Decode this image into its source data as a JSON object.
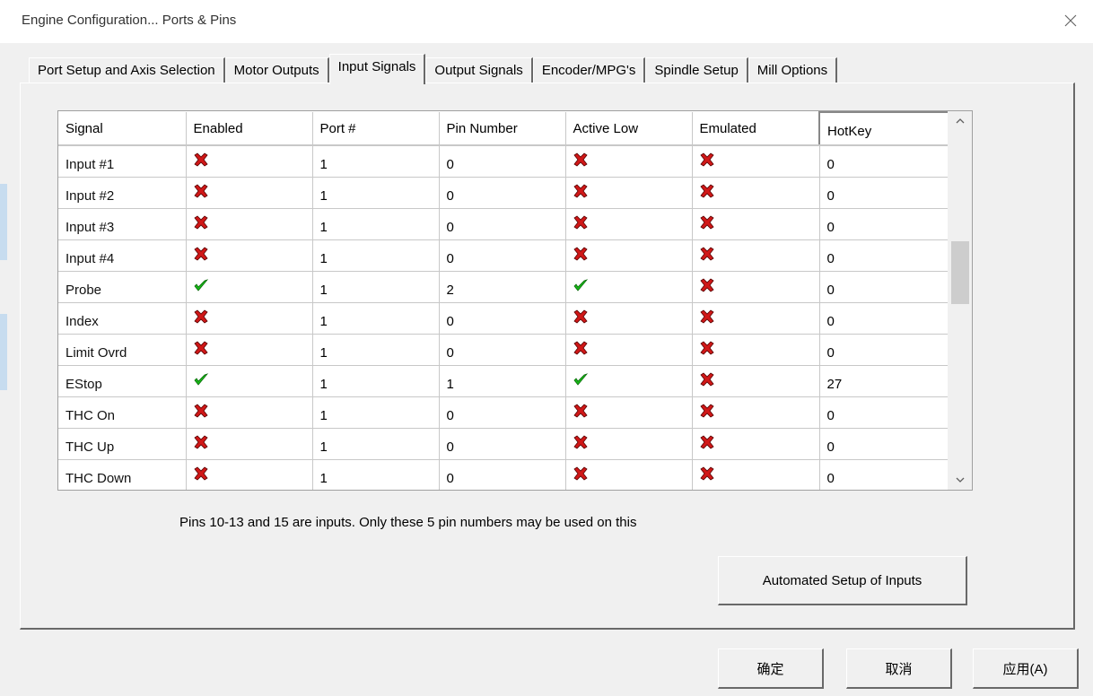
{
  "window": {
    "title": "Engine Configuration... Ports & Pins"
  },
  "tabs": [
    {
      "label": "Port Setup and Axis Selection"
    },
    {
      "label": "Motor Outputs"
    },
    {
      "label": "Input Signals"
    },
    {
      "label": "Output Signals"
    },
    {
      "label": "Encoder/MPG's"
    },
    {
      "label": "Spindle Setup"
    },
    {
      "label": "Mill Options"
    }
  ],
  "active_tab": "Input Signals",
  "table": {
    "columns": [
      "Signal",
      "Enabled",
      "Port #",
      "Pin Number",
      "Active Low",
      "Emulated",
      "HotKey"
    ],
    "rows": [
      {
        "signal": "Input #1",
        "enabled": "red-x-icon",
        "port": "1",
        "pin": "0",
        "active_low": "red-x-icon",
        "emulated": "red-x-icon",
        "hotkey": "0"
      },
      {
        "signal": "Input #2",
        "enabled": "red-x-icon",
        "port": "1",
        "pin": "0",
        "active_low": "red-x-icon",
        "emulated": "red-x-icon",
        "hotkey": "0"
      },
      {
        "signal": "Input #3",
        "enabled": "red-x-icon",
        "port": "1",
        "pin": "0",
        "active_low": "red-x-icon",
        "emulated": "red-x-icon",
        "hotkey": "0"
      },
      {
        "signal": "Input #4",
        "enabled": "red-x-icon",
        "port": "1",
        "pin": "0",
        "active_low": "red-x-icon",
        "emulated": "red-x-icon",
        "hotkey": "0"
      },
      {
        "signal": "Probe",
        "enabled": "green-check-icon",
        "port": "1",
        "pin": "2",
        "active_low": "green-check-icon",
        "emulated": "red-x-icon",
        "hotkey": "0"
      },
      {
        "signal": "Index",
        "enabled": "red-x-icon",
        "port": "1",
        "pin": "0",
        "active_low": "red-x-icon",
        "emulated": "red-x-icon",
        "hotkey": "0"
      },
      {
        "signal": "Limit Ovrd",
        "enabled": "red-x-icon",
        "port": "1",
        "pin": "0",
        "active_low": "red-x-icon",
        "emulated": "red-x-icon",
        "hotkey": "0"
      },
      {
        "signal": "EStop",
        "enabled": "green-check-icon",
        "port": "1",
        "pin": "1",
        "active_low": "green-check-icon",
        "emulated": "red-x-icon",
        "hotkey": "27"
      },
      {
        "signal": "THC On",
        "enabled": "red-x-icon",
        "port": "1",
        "pin": "0",
        "active_low": "red-x-icon",
        "emulated": "red-x-icon",
        "hotkey": "0"
      },
      {
        "signal": "THC Up",
        "enabled": "red-x-icon",
        "port": "1",
        "pin": "0",
        "active_low": "red-x-icon",
        "emulated": "red-x-icon",
        "hotkey": "0"
      },
      {
        "signal": "THC Down",
        "enabled": "red-x-icon",
        "port": "1",
        "pin": "0",
        "active_low": "red-x-icon",
        "emulated": "red-x-icon",
        "hotkey": "0"
      }
    ]
  },
  "info_text": "Pins 10-13 and 15 are inputs. Only these 5 pin numbers may be used on this",
  "buttons": {
    "automated_setup": "Automated Setup of Inputs",
    "ok": "确定",
    "cancel": "取消",
    "apply": "应用(A)"
  },
  "colors": {
    "red_x": "#d01818",
    "green_check": "#18b818",
    "background": "#f0f0f0"
  }
}
